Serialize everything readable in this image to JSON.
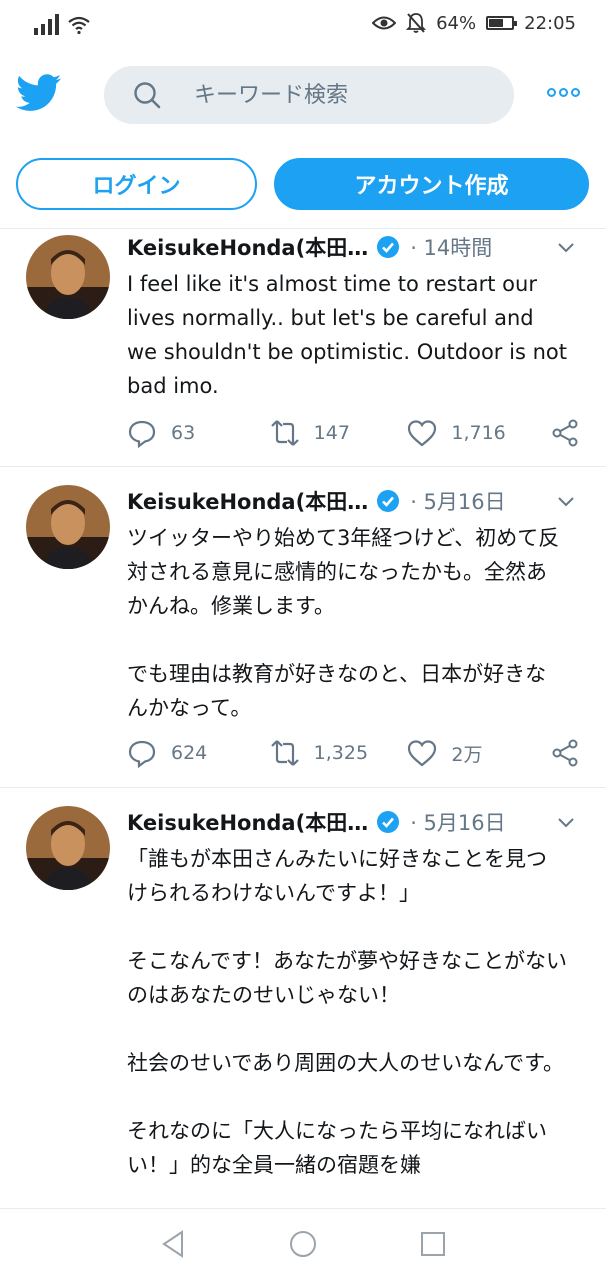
{
  "status_bar": {
    "battery": "64%",
    "battery_level": 0.64,
    "time": "22:05"
  },
  "header": {
    "search_placeholder": "キーワード検索"
  },
  "auth": {
    "login_label": "ログイン",
    "signup_label": "アカウント作成"
  },
  "tweets": [
    {
      "name": "KeisukeHonda(本田…",
      "time": "· 14時間",
      "text": "I feel like it's almost time to restart our lives normally.. but let's be careful and we shouldn't be optimistic. Outdoor is not bad imo.",
      "replies": "63",
      "retweets": "147",
      "likes": "1,716"
    },
    {
      "name": "KeisukeHonda(本田…",
      "time": "· 5月16日",
      "text": "ツイッターやり始めて3年経つけど、初めて反対される意見に感情的になったかも。全然あかんね。修業します。\n\nでも理由は教育が好きなのと、日本が好きなんかなって。",
      "replies": "624",
      "retweets": "1,325",
      "likes": "2万"
    },
    {
      "name": "KeisukeHonda(本田…",
      "time": "· 5月16日",
      "text": "「誰もが本田さんみたいに好きなことを見つけられるわけないんですよ！」\n\nそこなんです！あなたが夢や好きなことがないのはあなたのせいじゃない！\n\n社会のせいであり周囲の大人のせいなんです。\n\nそれなのに「大人になったら平均になればいい！」的な全員一緒の宿題を嫌"
    }
  ],
  "icons": {
    "logo": "twitter-bird-icon",
    "search": "search-icon",
    "more": "more-options-icon",
    "verified": "verified-badge-icon",
    "reply": "reply-icon",
    "retweet": "retweet-icon",
    "like": "heart-icon",
    "share": "share-icon",
    "back": "back-triangle-icon",
    "home": "home-circle-icon",
    "recents": "recents-square-icon"
  },
  "colors": {
    "brand": "#1da1f2",
    "text": "#14171a",
    "muted": "#657786",
    "search_bg": "#e6ecf0"
  }
}
